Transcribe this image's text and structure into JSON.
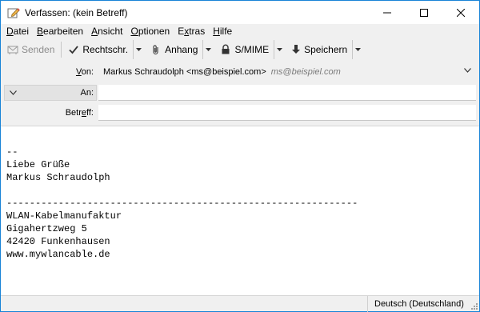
{
  "window": {
    "title": "Verfassen: (kein Betreff)",
    "icons": {
      "app": "compose-pencil-icon",
      "minimize": "minimize-icon",
      "maximize": "maximize-icon",
      "close": "close-icon"
    }
  },
  "menubar": {
    "items": [
      {
        "underline": "D",
        "rest": "atei"
      },
      {
        "underline": "B",
        "rest": "earbeiten"
      },
      {
        "underline": "A",
        "rest": "nsicht"
      },
      {
        "underline": "O",
        "rest": "ptionen"
      },
      {
        "before": "E",
        "underline": "x",
        "rest": "tras"
      },
      {
        "underline": "H",
        "rest": "ilfe"
      }
    ]
  },
  "toolbar": {
    "send": "Senden",
    "spellcheck": "Rechtschr.",
    "attach": "Anhang",
    "smime": "S/MIME",
    "save": "Speichern"
  },
  "headers": {
    "from": {
      "label_u": "V",
      "label_rest": "on:",
      "identity": "Markus Schraudolph <ms@beispiel.com>",
      "placeholder": "ms@beispiel.com"
    },
    "to": {
      "label": "An:"
    },
    "subject": {
      "label_before": "Betr",
      "label_u": "e",
      "label_rest": "ff:",
      "value": ""
    }
  },
  "body": {
    "text": "--\nLiebe Grüße\nMarkus Schraudolph\n\n-------------------------------------------------------------\nWLAN-Kabelmanufaktur\nGigahertzweg 5\n42420 Funkenhausen\nwww.mywlancable.de"
  },
  "statusbar": {
    "language": "Deutsch (Deutschland)"
  },
  "colors": {
    "window_border": "#1883d7",
    "chrome": "#f0f0f0",
    "disabled_text": "#8c8c8c"
  }
}
